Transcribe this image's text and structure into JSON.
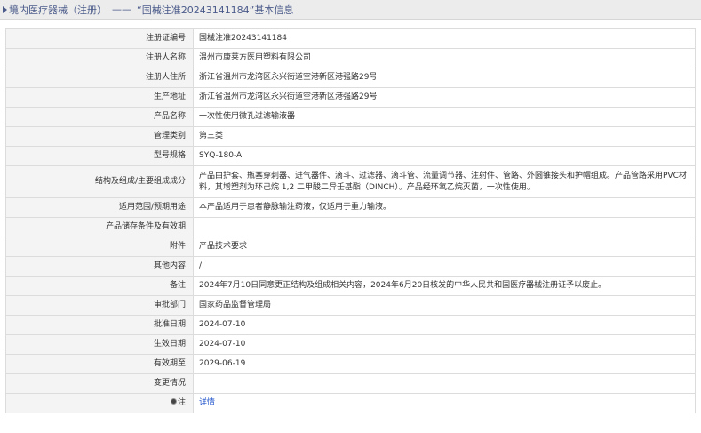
{
  "header": {
    "prefix": "境内医疗器械（注册）",
    "dash": "——",
    "title": "“国械注准20243141184”基本信息"
  },
  "rows": [
    {
      "key": "注册证编号",
      "value": "国械注准20243141184"
    },
    {
      "key": "注册人名称",
      "value": "温州市康莱方医用塑料有限公司"
    },
    {
      "key": "注册人住所",
      "value": "浙江省温州市龙湾区永兴街道空港新区港强路29号"
    },
    {
      "key": "生产地址",
      "value": "浙江省温州市龙湾区永兴街道空港新区港强路29号"
    },
    {
      "key": "产品名称",
      "value": "一次性使用微孔过滤输液器"
    },
    {
      "key": "管理类别",
      "value": "第三类"
    },
    {
      "key": "型号规格",
      "value": "SYQ-180-A"
    },
    {
      "key": "结构及组成/主要组成成分",
      "value": "产品由护套、瓶塞穿刺器、进气器件、滴斗、过滤器、滴斗管、流量调节器、注射件、管路、外圆锥接头和护帽组成。产品管路采用PVC材料，其增塑剂为环己烷 1,2 二甲酸二异壬基酯（DINCH）。产品经环氧乙烷灭菌，一次性使用。"
    },
    {
      "key": "适用范围/预期用途",
      "value": "本产品适用于患者静脉输注药液，仅适用于重力输液。"
    },
    {
      "key": "产品储存条件及有效期",
      "value": ""
    },
    {
      "key": "附件",
      "value": "产品技术要求"
    },
    {
      "key": "其他内容",
      "value": "/"
    },
    {
      "key": "备注",
      "value": "2024年7月10日同意更正结构及组成相关内容，2024年6月20日核发的中华人民共和国医疗器械注册证予以废止。"
    },
    {
      "key": "审批部门",
      "value": "国家药品监督管理局"
    },
    {
      "key": "批准日期",
      "value": "2024-07-10"
    },
    {
      "key": "生效日期",
      "value": "2024-07-10"
    },
    {
      "key": "有效期至",
      "value": "2029-06-19"
    },
    {
      "key": "变更情况",
      "value": ""
    }
  ],
  "note": {
    "key": "注",
    "link": "详情"
  }
}
